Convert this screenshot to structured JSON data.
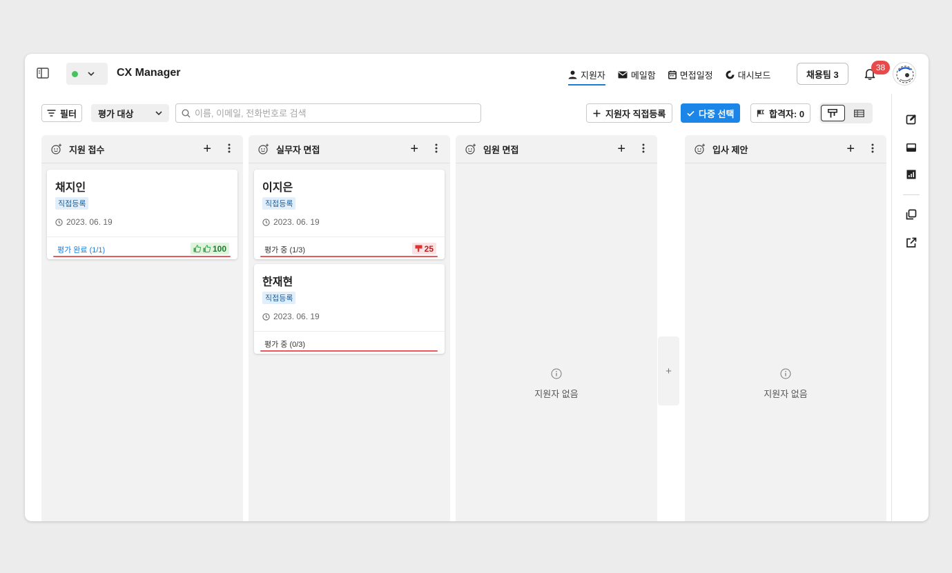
{
  "header": {
    "app_title": "CX Manager",
    "nav": [
      {
        "label": "지원자",
        "icon": "person-icon",
        "active": true
      },
      {
        "label": "메일함",
        "icon": "mail-icon",
        "active": false
      },
      {
        "label": "면접일정",
        "icon": "calendar-icon",
        "active": false
      },
      {
        "label": "대시보드",
        "icon": "donut-chart-icon",
        "active": false
      }
    ],
    "team_button": "채용팀 3",
    "notification_count": "38",
    "status_color": "#46c35b"
  },
  "toolbar": {
    "filter_label": "필터",
    "eval_select_value": "평가 대상",
    "search_placeholder": "이름, 이메일, 전화번호로 검색",
    "add_applicant_label": "지원자 직접등록",
    "multi_select_label": "다중 선택",
    "passed_label": "합격자: 0",
    "accent_color": "#1b86e8"
  },
  "columns": [
    {
      "title": "지원 접수",
      "cards": [
        {
          "name": "채지인",
          "tag": "직접등록",
          "date": "2023. 06. 19",
          "status": "평가 완료 (1/1)",
          "score": "100",
          "score_type": "good"
        }
      ]
    },
    {
      "title": "실무자 면접",
      "cards": [
        {
          "name": "이지은",
          "tag": "직접등록",
          "date": "2023. 06. 19",
          "status": "평가 중 (1/3)",
          "score": "25",
          "score_type": "bad"
        },
        {
          "name": "한재현",
          "tag": "직접등록",
          "date": "2023. 06. 19",
          "status": "평가 중 (0/3)",
          "score": "",
          "score_type": "none"
        }
      ]
    },
    {
      "title": "임원 면접",
      "cards": [],
      "empty_label": "지원자 없음"
    },
    {
      "title": "입사 제안",
      "cards": [],
      "empty_label": "지원자 없음"
    }
  ],
  "add_column_label": "+",
  "add_symbol": "+"
}
